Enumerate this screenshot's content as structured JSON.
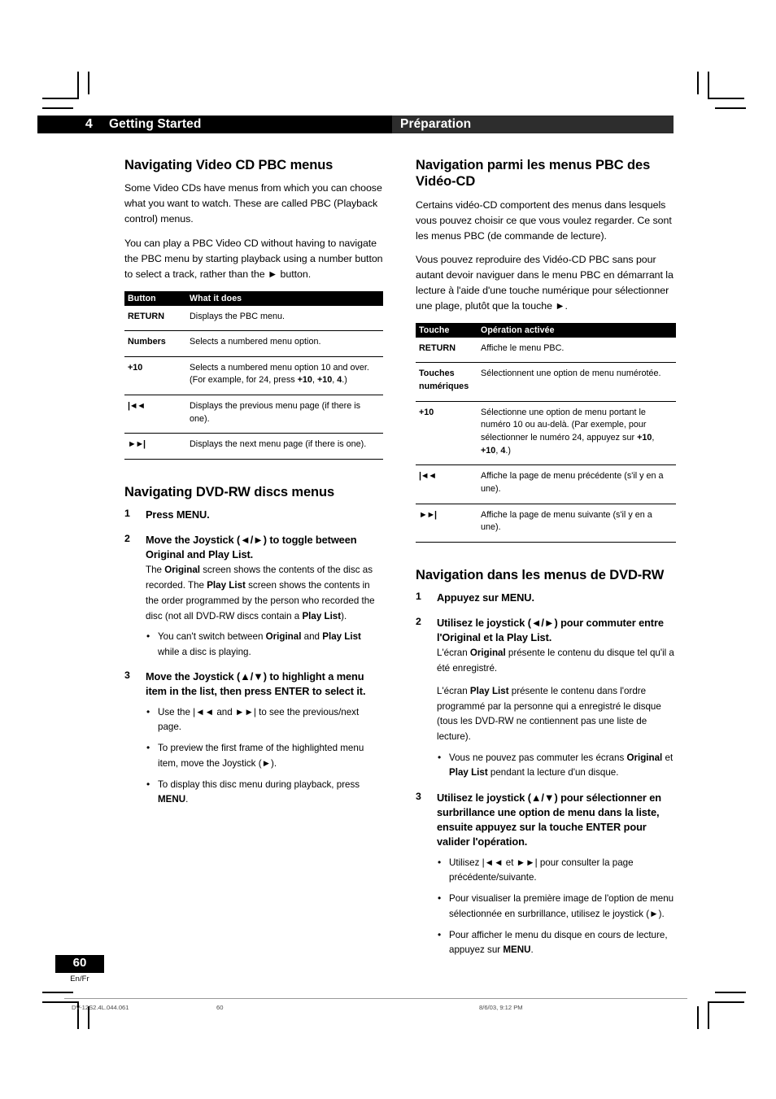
{
  "header": {
    "chapter_number": "4",
    "title_en": "Getting Started",
    "title_fr": "Préparation"
  },
  "english": {
    "section1_heading": "Navigating Video CD PBC menus",
    "section1_paragraphs": [
      "Some Video CDs have menus from which you can choose what you want to watch. These are called PBC (Playback control) menus.",
      "You can play a PBC Video CD without having to navigate the PBC menu by starting playback using a number button to select a track, rather than the ► button."
    ],
    "table": {
      "headers": [
        "Button",
        "What it does"
      ],
      "rows": [
        {
          "button": "RETURN",
          "desc": "Displays the PBC menu."
        },
        {
          "button": "Numbers",
          "desc": "Selects a numbered menu option."
        },
        {
          "button": "+10",
          "desc": "Selects a numbered menu option 10 and over. (For example, for 24, press +10, +10, 4.)"
        },
        {
          "button": "|◄◄",
          "desc": "Displays the previous menu page (if there is one)."
        },
        {
          "button": "►►|",
          "desc": "Displays the next menu page (if there is one)."
        }
      ]
    },
    "section2_heading": "Navigating DVD-RW discs menus",
    "steps": [
      {
        "num": "1",
        "head": "Press MENU.",
        "body": [],
        "bullets": []
      },
      {
        "num": "2",
        "head": "Move the Joystick (◄/►) to toggle between Original and Play List.",
        "body": [
          "The Original screen shows the contents of the disc as recorded. The Play List screen shows the contents in the order programmed by the person who recorded the disc (not all DVD-RW discs contain a Play List)."
        ],
        "bullets": [
          "You can't switch between Original and Play List while a disc is playing."
        ]
      },
      {
        "num": "3",
        "head": "Move the Joystick (▲/▼) to highlight a menu item in the list, then press ENTER to select it.",
        "body": [],
        "bullets": [
          "Use the |◄◄ and ►►| to see the previous/next page.",
          "To preview the first frame of the highlighted menu item, move the Joystick (►).",
          "To display this disc menu during playback, press MENU."
        ]
      }
    ]
  },
  "french": {
    "section1_heading": "Navigation parmi les menus PBC des Vidéo-CD",
    "section1_paragraphs": [
      "Certains vidéo-CD comportent des menus dans lesquels vous pouvez choisir ce que vous voulez regarder. Ce sont les menus PBC (de commande de lecture).",
      "Vous pouvez reproduire des Vidéo-CD PBC sans pour autant devoir naviguer dans le menu PBC en démarrant la lecture à l'aide d'une touche numérique pour sélectionner une plage, plutôt que la touche ►."
    ],
    "table": {
      "headers": [
        "Touche",
        "Opération activée"
      ],
      "rows": [
        {
          "button": "RETURN",
          "desc": "Affiche le menu PBC."
        },
        {
          "button": "Touches numériques",
          "desc": "Sélectionnent une option de menu numérotée."
        },
        {
          "button": "+10",
          "desc": "Sélectionne une option de menu portant le numéro 10 ou au-delà. (Par exemple, pour sélectionner le numéro 24, appuyez sur +10, +10, 4.)"
        },
        {
          "button": "|◄◄",
          "desc": "Affiche la page de menu précédente (s'il y en a une)."
        },
        {
          "button": "►►|",
          "desc": "Affiche la page de menu suivante (s'il y en a une)."
        }
      ]
    },
    "section2_heading": "Navigation dans les menus de DVD-RW",
    "steps": [
      {
        "num": "1",
        "head": "Appuyez sur MENU.",
        "body": [],
        "bullets": []
      },
      {
        "num": "2",
        "head": "Utilisez le joystick (◄/►)  pour commuter entre l'Original et la Play List.",
        "body": [
          "L'écran Original présente le contenu du disque tel qu'il a été enregistré.",
          "L'écran Play List présente le contenu dans l'ordre programmé par la personne qui a enregistré le disque (tous les DVD-RW ne contiennent pas une liste de lecture)."
        ],
        "bullets": [
          "Vous ne pouvez pas commuter les écrans Original et Play List pendant la lecture d'un disque."
        ]
      },
      {
        "num": "3",
        "head": "Utilisez le joystick (▲/▼)  pour sélectionner en surbrillance une option de menu dans la liste, ensuite appuyez sur la touche ENTER pour valider l'opération.",
        "body": [],
        "bullets": [
          "Utilisez |◄◄ et ►►| pour consulter la page précédente/suivante.",
          "Pour visualiser la première image de l'option de menu sélectionnée en surbrillance, utilisez le joystick (►).",
          "Pour afficher le menu du disque en cours de lecture, appuyez sur MENU."
        ]
      }
    ]
  },
  "footer": {
    "page_number": "60",
    "page_language": "En/Fr",
    "print_job_id": "DV-12S2.4L.044.061",
    "print_page": "60",
    "print_date": "8/6/03, 9:12 PM"
  }
}
